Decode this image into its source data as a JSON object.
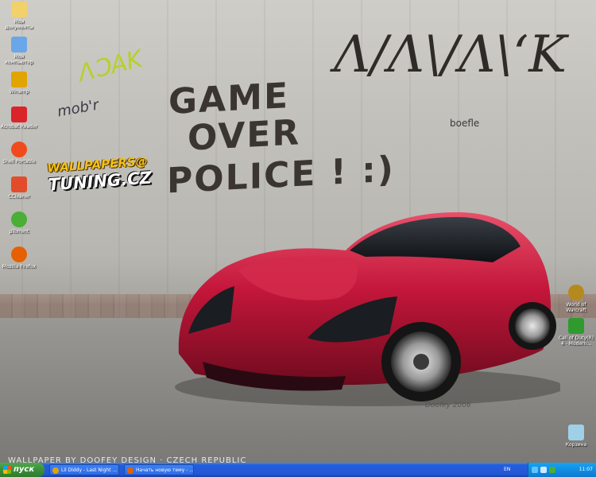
{
  "desktop": {
    "icons_left": [
      {
        "label": "Мои документы",
        "icon": "my-documents-icon",
        "color": "#f2d16b"
      },
      {
        "label": "Мой компьютер",
        "icon": "my-computer-icon",
        "color": "#6aa6e8"
      },
      {
        "label": "Winamp",
        "icon": "winamp-icon",
        "color": "#e2a400"
      },
      {
        "label": "Acrobat Reader",
        "icon": "acrobat-icon",
        "color": "#d9242a"
      },
      {
        "label": "Shell Portable",
        "icon": "shell-icon",
        "color": "#f04b1c"
      },
      {
        "label": "CCleaner",
        "icon": "ccleaner-icon",
        "color": "#e24c2a"
      },
      {
        "label": "µTorrent",
        "icon": "utorrent-icon",
        "color": "#4aae37"
      },
      {
        "label": "Mozilla Firefox",
        "icon": "firefox-icon",
        "color": "#e66000"
      }
    ],
    "icons_right": [
      {
        "label": "World of Warcraft",
        "icon": "warcraft-icon",
        "color": "#b58a1d"
      },
      {
        "label": "Call of Duty(R) 4 - Modern...",
        "icon": "call-of-duty-icon",
        "color": "#2f9b2f"
      }
    ],
    "recycle_bin": {
      "label": "Корзина",
      "icon": "recycle-bin-icon",
      "color": "#9fd0e8"
    }
  },
  "wallpaper": {
    "graffiti_line1": "GAME",
    "graffiti_line2": "OVER",
    "graffiti_line3": "POLICE ! :)",
    "graffiti_side": "Λ/Λ\\/Λ\\ʻK",
    "graffiti_green": "ɅƆAK",
    "graffiti_small": "mob'r",
    "graffiti_tag": "boefle",
    "logo_line1": "WALLPAPERS@",
    "logo_line2": "TUNING.CZ",
    "credit": "WALLPAPER BY DOOFEY DESIGN · CZECH REPUBLIC",
    "signature": "Doofey 2006"
  },
  "taskbar": {
    "start_label": "пуск",
    "tasks": [
      {
        "label": "Lil Diddy - Last Night ...",
        "icon": "media-player-icon",
        "color": "#e2a400"
      },
      {
        "label": "Начать новую тему - ...",
        "icon": "firefox-icon",
        "color": "#e66000"
      }
    ],
    "language": "EN",
    "clock": "11:07"
  }
}
